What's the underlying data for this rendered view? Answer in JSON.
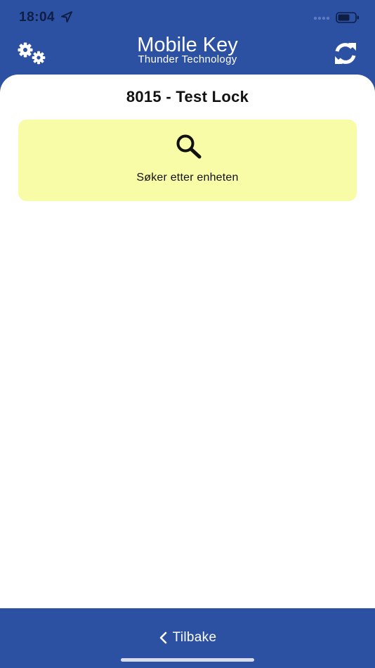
{
  "status_bar": {
    "time": "18:04"
  },
  "header": {
    "title": "Mobile Key",
    "subtitle": "Thunder Technology"
  },
  "main": {
    "lock_title": "8015 - Test Lock",
    "status_card": {
      "text": "Søker etter enheten",
      "color": "#f8fca6"
    }
  },
  "footer": {
    "back_label": "Tilbake"
  },
  "colors": {
    "brand": "#2c51a3",
    "card": "#f8fca6"
  },
  "icons": [
    "location-arrow-icon",
    "signal-icon",
    "battery-icon",
    "gears-icon",
    "refresh-icon",
    "search-icon",
    "chevron-left-icon"
  ]
}
